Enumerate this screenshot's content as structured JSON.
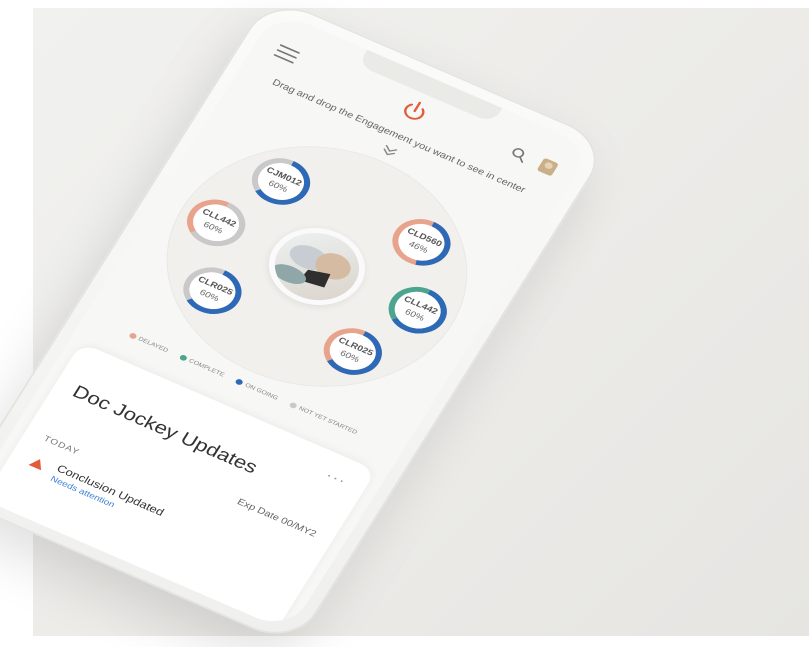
{
  "colors": {
    "delayed": "#e8a38c",
    "complete": "#4ea58f",
    "on_going": "#2e69b8",
    "not_yet_started": "#c9c9c9",
    "link": "#3b7fd4",
    "alert": "#e25c3b"
  },
  "icons": {
    "menu": "menu-icon",
    "logo": "app-logo-icon",
    "search": "search-icon",
    "user": "user-avatar-icon",
    "scroll": "chevron-down-icon",
    "more": "more-icon",
    "alert": "warning-icon"
  },
  "header": {
    "instruction": "Drag and drop the Engagement you want to see in center"
  },
  "engagements": [
    {
      "code": "CJM012",
      "percent": "60%",
      "progress": 0.6
    },
    {
      "code": "CLD560",
      "percent": "46%",
      "progress": 0.46
    },
    {
      "code": "CLL442",
      "percent": "60%",
      "progress": 0.6
    },
    {
      "code": "CLR025",
      "percent": "60%",
      "progress": 0.6
    },
    {
      "code": "CLR025",
      "percent": "60%",
      "progress": 0.6
    },
    {
      "code": "CLL442",
      "percent": "60%",
      "progress": 0.6
    }
  ],
  "legend": [
    {
      "label": "DELAYED",
      "color": "#e8a38c"
    },
    {
      "label": "COMPLETE",
      "color": "#4ea58f"
    },
    {
      "label": "ON GOING",
      "color": "#2e69b8"
    },
    {
      "label": "NOT YET STARTED",
      "color": "#c9c9c9"
    }
  ],
  "card": {
    "more": "...",
    "title": "Doc Jockey Updates",
    "exp_date": "Exp Date 00/MY2",
    "today": "TODAY",
    "update": "Conclusion Updated",
    "note": "Needs attention"
  }
}
